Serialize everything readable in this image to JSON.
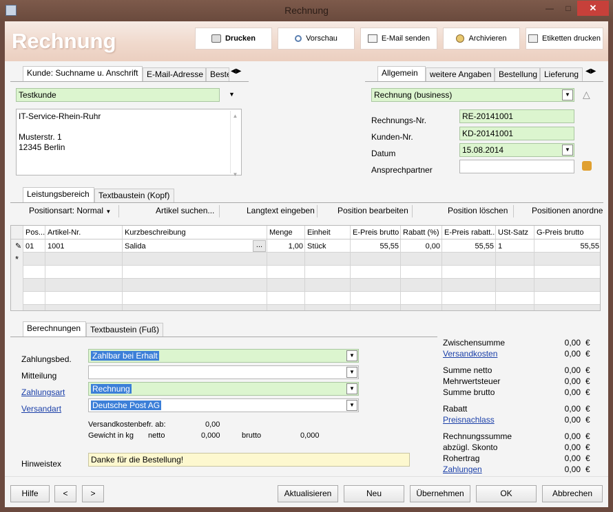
{
  "window": {
    "title": "Rechnung"
  },
  "header": {
    "title": "Rechnung",
    "buttons": {
      "print": "Drucken",
      "preview": "Vorschau",
      "email": "E-Mail senden",
      "archive": "Archivieren",
      "labels": "Etiketten drucken"
    }
  },
  "customer": {
    "tabs": [
      "Kunde: Suchname u. Anschrift",
      "E-Mail-Adresse",
      "Beste"
    ],
    "search_value": "Testkunde",
    "address_lines": [
      "IT-Service-Rhein-Ruhr",
      "",
      "Musterstr. 1",
      "12345 Berlin"
    ]
  },
  "general": {
    "tabs": [
      "Allgemein",
      "weitere Angaben",
      "Bestellung",
      "Lieferung"
    ],
    "doc_type": "Rechnung (business)",
    "fields": {
      "invoice_no_label": "Rechnungs-Nr.",
      "invoice_no": "RE-20141001",
      "customer_no_label": "Kunden-Nr.",
      "customer_no": "KD-20141001",
      "date_label": "Datum",
      "date": "15.08.2014",
      "contact_label": "Ansprechpartner",
      "contact": ""
    }
  },
  "positions": {
    "tabs": [
      "Leistungsbereich",
      "Textbaustein (Kopf)"
    ],
    "toolbar": {
      "position_type": "Positionsart: Normal",
      "search_article": "Artikel suchen...",
      "longtext": "Langtext eingeben",
      "edit": "Position bearbeiten",
      "delete": "Position löschen",
      "arrange": "Positionen anordne"
    },
    "columns": [
      "Pos...",
      "Artikel-Nr.",
      "Kurzbeschreibung",
      "Menge",
      "Einheit",
      "E-Preis brutto",
      "Rabatt (%)",
      "E-Preis rabatt...",
      "USt-Satz",
      "G-Preis brutto"
    ],
    "rows": [
      {
        "pos": "01",
        "article": "1001",
        "desc": "Salida",
        "qty": "1,00",
        "unit": "Stück",
        "price": "55,55",
        "discount": "0,00",
        "price_disc": "55,55",
        "vat": "1",
        "total": "55,55"
      }
    ],
    "ellipsis": "...",
    "new_row_marker": "*"
  },
  "calc": {
    "tabs": [
      "Berechnungen",
      "Textbaustein (Fuß)"
    ],
    "payment_terms_label": "Zahlungsbed.",
    "payment_terms": "Zahlbar bei Erhalt",
    "message_label": "Mitteilung",
    "message": "",
    "payment_type_label": "Zahlungsart",
    "payment_type": "Rechnung",
    "shipping_type_label": "Versandart",
    "shipping_type": "Deutsche Post AG",
    "free_shipping_label": "Versandkostenbefr. ab:",
    "free_shipping_value": "0,00",
    "weight_label": "Gewicht in kg",
    "net_label": "netto",
    "net_value": "0,000",
    "gross_label": "brutto",
    "gross_value": "0,000",
    "note_label": "Hinweistex",
    "note_value": "Danke für die Bestellung!"
  },
  "totals": {
    "currency": "€",
    "items": [
      {
        "label": "Zwischensumme",
        "value": "0,00",
        "link": false
      },
      {
        "label": "Versandkosten",
        "value": "0,00",
        "link": true
      },
      {
        "label": "Summe netto",
        "value": "0,00",
        "link": false
      },
      {
        "label": "Mehrwertsteuer",
        "value": "0,00",
        "link": false
      },
      {
        "label": "Summe brutto",
        "value": "0,00",
        "link": false
      },
      {
        "label": "Rabatt",
        "value": "0,00",
        "link": false
      },
      {
        "label": "Preisnachlass",
        "value": "0,00",
        "link": true
      },
      {
        "label": "Rechnungssumme",
        "value": "0,00",
        "link": false
      },
      {
        "label": "abzügl. Skonto",
        "value": "0,00",
        "link": false
      },
      {
        "label": "Rohertrag",
        "value": "0,00",
        "link": false
      },
      {
        "label": "Zahlungen",
        "value": "0,00",
        "link": true
      }
    ]
  },
  "footer": {
    "help": "Hilfe",
    "prev": "<",
    "next": ">",
    "refresh": "Aktualisieren",
    "new": "Neu",
    "apply": "Übernehmen",
    "ok": "OK",
    "cancel": "Abbrechen"
  }
}
